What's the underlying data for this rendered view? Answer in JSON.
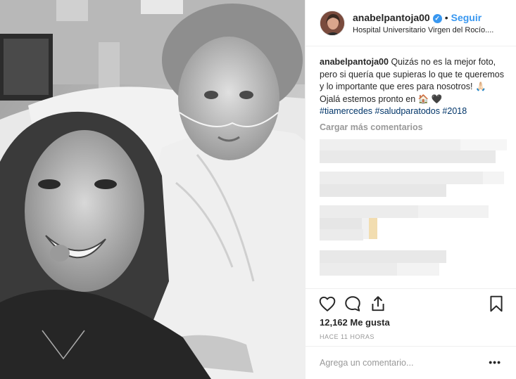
{
  "post": {
    "photo_alt": "",
    "header": {
      "username": "anabelpantoja00",
      "verified": true,
      "separator": "•",
      "follow_label": "Seguir",
      "location": "Hospital Universitario Virgen del Rocío...."
    },
    "caption": {
      "username": "anabelpantoja00",
      "text_line1": "Quizás no es la mejor foto, pero si quería que supieras lo que te queremos y lo importante que eres para nosotros! 🙏🏻",
      "text_line2": "Ojalá estemos pronto en 🏠 🖤",
      "hashtags": "#tiamercedes #saludparatodos #2018"
    },
    "load_more_label": "Cargar más comentarios",
    "likes_text": "12,162 Me gusta",
    "time_ago": "HACE 11 HORAS",
    "comment_placeholder": "Agrega un comentario...",
    "options_label": "•••",
    "icons": {
      "like": "heart-icon",
      "comment": "comment-icon",
      "share": "share-icon",
      "save": "bookmark-icon",
      "verified": "verified-badge-icon"
    },
    "colors": {
      "accent": "#3897f0",
      "hashtag": "#003569",
      "muted": "#999999"
    }
  }
}
